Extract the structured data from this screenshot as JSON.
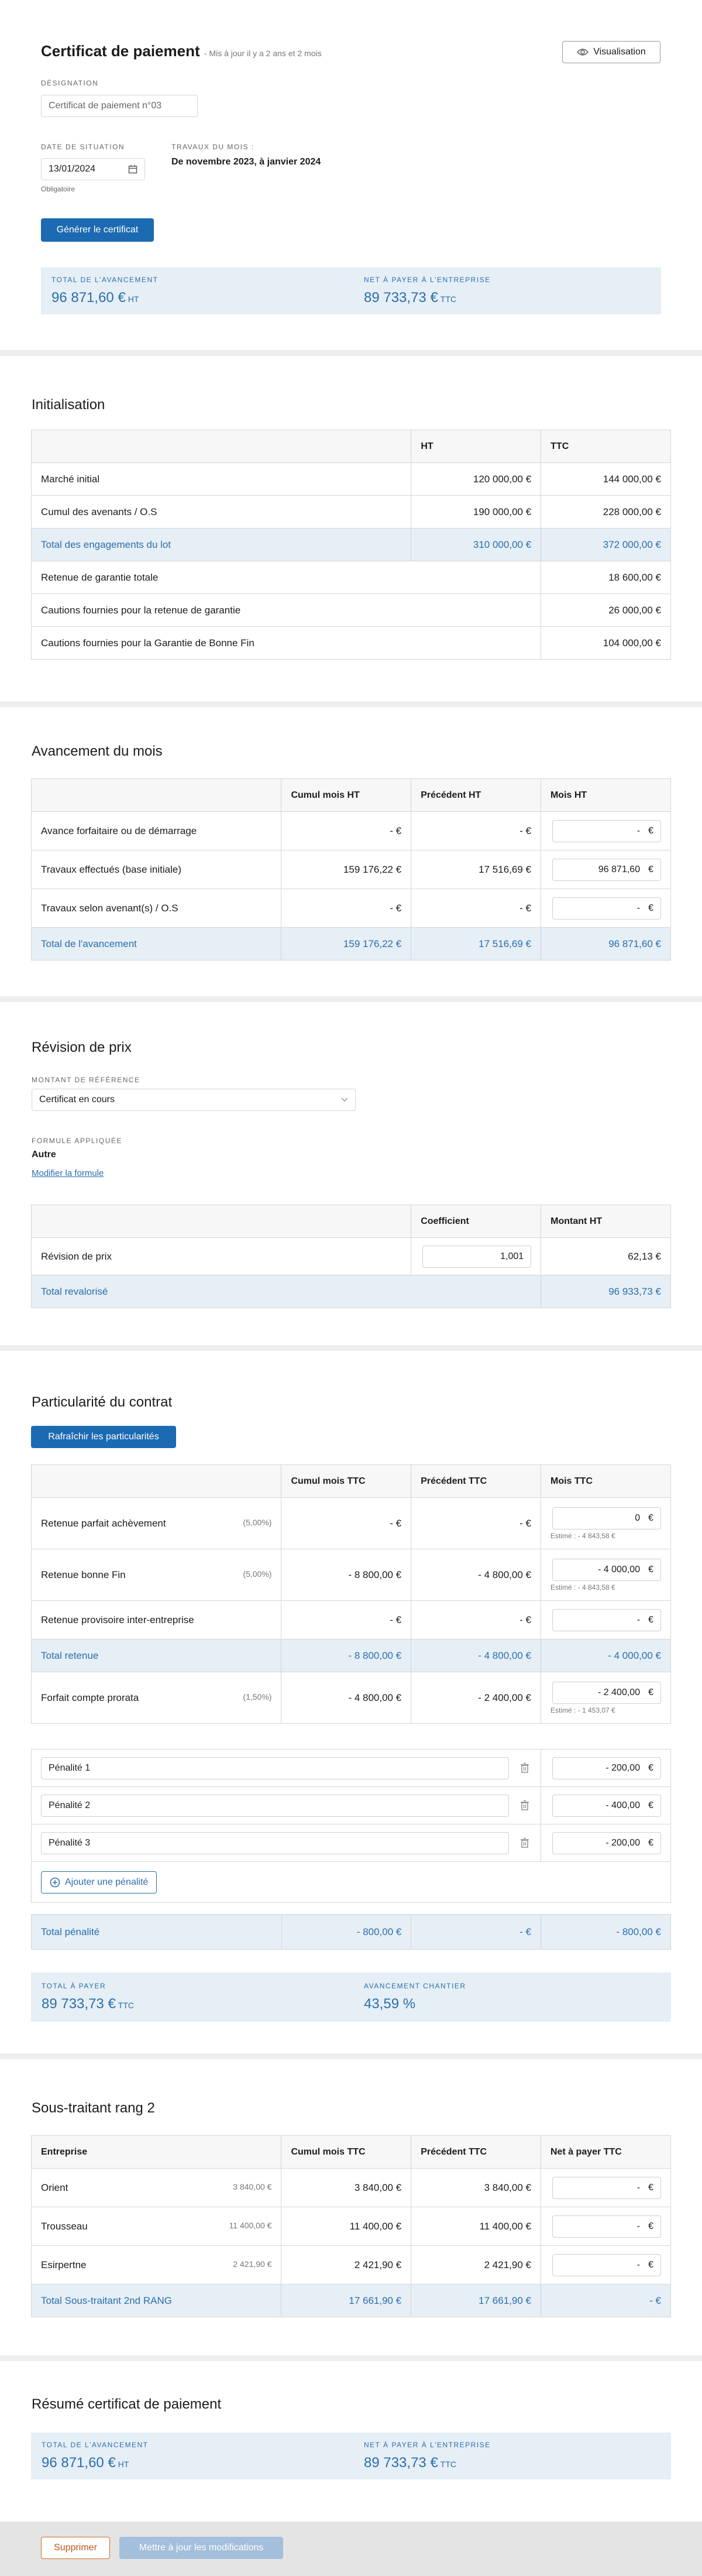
{
  "header": {
    "title": "Certificat de paiement",
    "updated": "- Mis à jour il y a 2 ans et 2 mois",
    "visualisation_label": "Visualisation",
    "designation_label": "DÉSIGNATION",
    "designation_value": "Certificat de paiement n°03",
    "date_label": "DATE DE SITUATION",
    "date_value": "13/01/2024",
    "date_required": "Obligatoire",
    "travaux_label": "TRAVAUX DU MOIS :",
    "travaux_value": "De novembre 2023, à janvier 2024",
    "generate_label": "Générer le certificat",
    "total_label": "TOTAL DE L'AVANCEMENT",
    "total_value": "96 871,60 €",
    "total_unit": "HT",
    "net_label": "NET À PAYER À L'ENTREPRISE",
    "net_value": "89 733,73 €",
    "net_unit": "TTC"
  },
  "init": {
    "title": "Initialisation",
    "columns": [
      "",
      "HT",
      "TTC"
    ],
    "rows": [
      {
        "label": "Marché initial",
        "ht": "120 000,00 €",
        "ttc": "144 000,00 €"
      },
      {
        "label": "Cumul des avenants / O.S",
        "ht": "190 000,00 €",
        "ttc": "228 000,00 €"
      },
      {
        "label": "Total des engagements du lot",
        "ht": "310 000,00 €",
        "ttc": "372 000,00 €"
      },
      {
        "label": "Retenue de garantie totale",
        "ttc": "18 600,00 €"
      },
      {
        "label": "Cautions fournies pour la retenue de garantie",
        "ttc": "26 000,00 €"
      },
      {
        "label": "Cautions fournies pour la Garantie de Bonne Fin",
        "ttc": "104 000,00 €"
      }
    ]
  },
  "avancement": {
    "title": "Avancement du mois",
    "columns": [
      "",
      "Cumul mois HT",
      "Précédent HT",
      "Mois HT"
    ],
    "rows": [
      {
        "label": "Avance forfaitaire ou de démarrage",
        "cumul": "- €",
        "prec": "- €",
        "mois": "-"
      },
      {
        "label": "Travaux effectués (base initiale)",
        "cumul": "159 176,22 €",
        "prec": "17 516,69 €",
        "mois": "96 871,60"
      },
      {
        "label": "Travaux selon avenant(s) / O.S",
        "cumul": "- €",
        "prec": "- €",
        "mois": "-"
      },
      {
        "label": "Total de l'avancement",
        "cumul": "159 176,22 €",
        "prec": "17 516,69 €",
        "mois": "96 871,60 €"
      }
    ],
    "euro": "€"
  },
  "revision": {
    "title": "Révision de prix",
    "ref_label": "MONTANT DE RÉFÉRENCE",
    "ref_value": "Certificat en cours",
    "formule_label": "FORMULE APPLIQUÉE",
    "formule_value": "Autre",
    "modify_label": "Modifier la formule",
    "columns": [
      "",
      "Coefficient",
      "Montant HT"
    ],
    "rows": [
      {
        "label": "Révision de prix",
        "coef": "1,001",
        "montant": "62,13 €"
      },
      {
        "label": "Total revalorisé",
        "montant": "96 933,73 €"
      }
    ]
  },
  "particularite": {
    "title": "Particularité du contrat",
    "refresh_label": "Rafraîchir les particularités",
    "columns": [
      "",
      "Cumul mois TTC",
      "Précédent TTC",
      "Mois TTC"
    ],
    "rows": [
      {
        "label": "Retenue parfait achèvement",
        "pct": "(5,00%)",
        "cumul": "- €",
        "prec": "- €",
        "mois": "0",
        "est": "Estimé : - 4 843,58 €"
      },
      {
        "label": "Retenue bonne Fin",
        "pct": "(5,00%)",
        "cumul": "- 8 800,00 €",
        "prec": "- 4 800,00 €",
        "mois": "- 4 000,00",
        "est": "Estimé : - 4 843,58 €"
      },
      {
        "label": "Retenue provisoire inter-entreprise",
        "cumul": "- €",
        "prec": "- €",
        "mois": "-"
      },
      {
        "label": "Total retenue",
        "cumul": "- 8 800,00 €",
        "prec": "- 4 800,00 €",
        "mois": "- 4 000,00 €"
      },
      {
        "label": "Forfait compte prorata",
        "pct": "(1,50%)",
        "cumul": "- 4 800,00 €",
        "prec": "- 2 400,00 €",
        "mois": "- 2 400,00",
        "est": "Estimé : - 1 453,07 €"
      }
    ],
    "penalites": [
      {
        "name": "Pénalité 1",
        "value": "- 200,00"
      },
      {
        "name": "Pénalité 2",
        "value": "- 400,00"
      },
      {
        "name": "Pénalité 3",
        "value": "- 200,00"
      }
    ],
    "add_penalite": "Ajouter une pénalité",
    "total_penalite": {
      "label": "Total pénalité",
      "cumul": "- 800,00 €",
      "prec": "- €",
      "mois": "- 800,00 €"
    },
    "total_payer_label": "TOTAL À PAYER",
    "total_payer_value": "89 733,73 €",
    "total_payer_unit": "TTC",
    "avancement_label": "AVANCEMENT CHANTIER",
    "avancement_value": "43,59 %"
  },
  "soustraitant": {
    "title": "Sous-traitant rang 2",
    "columns": [
      "Entreprise",
      "Cumul mois TTC",
      "Précédent TTC",
      "Net à payer TTC"
    ],
    "rows": [
      {
        "name": "Orient",
        "sub": "3 840,00 €",
        "cumul": "3 840,00 €",
        "prec": "3 840,00 €",
        "net": "-"
      },
      {
        "name": "Trousseau",
        "sub": "11 400,00 €",
        "cumul": "11 400,00 €",
        "prec": "11 400,00 €",
        "net": "-"
      },
      {
        "name": "Esirpertne",
        "sub": "2 421,90 €",
        "cumul": "2 421,90 €",
        "prec": "2 421,90 €",
        "net": "-"
      }
    ],
    "total": {
      "label": "Total Sous-traitant 2nd RANG",
      "cumul": "17 661,90 €",
      "prec": "17 661,90 €",
      "net": "- €"
    }
  },
  "resume": {
    "title": "Résumé certificat de paiement",
    "total_label": "TOTAL DE L'AVANCEMENT",
    "total_value": "96 871,60 €",
    "total_unit": "HT",
    "net_label": "NET À PAYER À L'ENTREPRISE",
    "net_value": "89 733,73 €",
    "net_unit": "TTC"
  },
  "footer": {
    "delete_label": "Supprimer",
    "update_label": "Mettre à jour les modifications"
  }
}
